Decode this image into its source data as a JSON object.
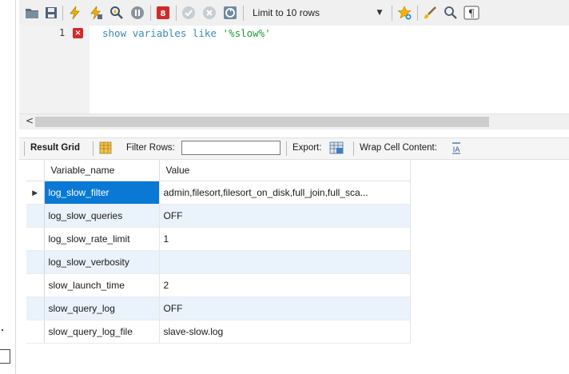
{
  "toolbar": {
    "limit_select": {
      "value": "Limit to 10 rows"
    },
    "icons": [
      "folder-icon",
      "save-icon",
      "execute-icon",
      "execute-current-icon",
      "explain-icon",
      "stop-icon",
      "toggle-error-icon",
      "commit-icon",
      "rollback-icon",
      "autocommit-icon",
      "beautify-icon",
      "brush-icon",
      "find-icon",
      "invisible-chars-icon"
    ]
  },
  "editor": {
    "line_number": "1",
    "code": {
      "keyword": "show variables like",
      "string": "'%slow%'"
    }
  },
  "result_toolbar": {
    "result_grid_label": "Result Grid",
    "filter_rows_label": "Filter Rows:",
    "filter_value": "",
    "export_label": "Export:",
    "wrap_label": "Wrap Cell Content:"
  },
  "grid": {
    "columns": [
      "Variable_name",
      "Value"
    ],
    "rows": [
      {
        "name": "log_slow_filter",
        "value": "admin,filesort,filesort_on_disk,full_join,full_sca..."
      },
      {
        "name": "log_slow_queries",
        "value": "OFF"
      },
      {
        "name": "log_slow_rate_limit",
        "value": "1"
      },
      {
        "name": "log_slow_verbosity",
        "value": ""
      },
      {
        "name": "slow_launch_time",
        "value": "2"
      },
      {
        "name": "slow_query_log",
        "value": "OFF"
      },
      {
        "name": "slow_query_log_file",
        "value": "slave-slow.log"
      }
    ]
  },
  "colors": {
    "selection": "#0a79d6",
    "alt_row": "#eaf2fb",
    "keyword": "#3a8ab8",
    "string": "#1c9a3a",
    "error": "#d4282a"
  }
}
